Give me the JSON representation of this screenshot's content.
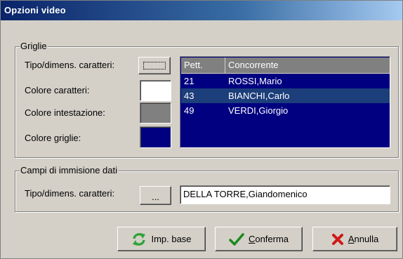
{
  "window": {
    "title": "Opzioni video"
  },
  "griglie": {
    "legend": "Griglie",
    "font_label": "Tipo/dimens. caratteri:",
    "text_color_label": "Colore caratteri:",
    "header_color_label": "Colore intestazione:",
    "grid_color_label": "Colore griglie:",
    "text_color": "#ffffff",
    "header_color": "#808080",
    "grid_color": "#000080"
  },
  "preview_grid": {
    "columns": [
      "Pett.",
      "Concorrente"
    ],
    "rows": [
      [
        "21",
        "ROSSI,Mario"
      ],
      [
        "43",
        "BIANCHI,Carlo"
      ],
      [
        "49",
        "VERDI,Giorgio"
      ]
    ]
  },
  "campi": {
    "legend": "Campi di immisione dati",
    "font_label": "Tipo/dimens. caratteri:",
    "font_button": "...",
    "sample_value": "DELLA TORRE,Giandomenico"
  },
  "buttons": {
    "imp_base": "Imp. base",
    "conferma_first": "C",
    "conferma_rest": "onferma",
    "annulla_first": "A",
    "annulla_rest": "nnulla"
  },
  "icons": {
    "imp_base": "refresh-arrows-icon",
    "conferma": "check-icon",
    "annulla": "x-icon"
  },
  "colors": {
    "title_bar": "#0a246a",
    "refresh_icon": "#2fa33a",
    "check_icon": "#1e8a1e",
    "x_icon": "#d01818"
  }
}
